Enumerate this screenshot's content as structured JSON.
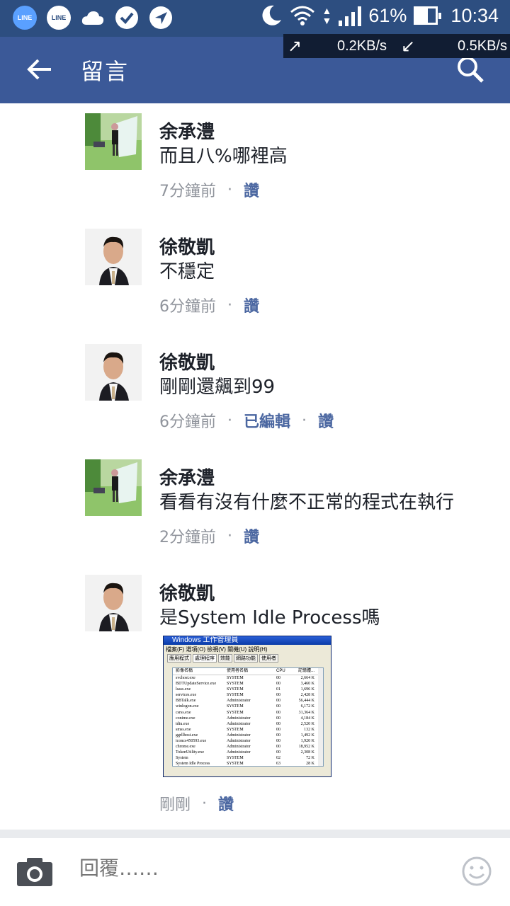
{
  "status_bar": {
    "battery": "61%",
    "time": "10:34",
    "upload": "0.2KB/s",
    "download": "0.5KB/s",
    "line_badge_1": "LINE",
    "line_badge_2": "LINE"
  },
  "app_bar": {
    "title": "留言"
  },
  "comments": [
    {
      "name": "余承澧",
      "text": "而且八%哪裡高",
      "time": "7分鐘前",
      "edited": "",
      "like": "讚",
      "avatar": "park"
    },
    {
      "name": "徐敬凱",
      "text": "不穩定",
      "time": "6分鐘前",
      "edited": "",
      "like": "讚",
      "avatar": "man"
    },
    {
      "name": "徐敬凱",
      "text": "剛剛還飆到99",
      "time": "6分鐘前",
      "edited": "已編輯",
      "like": "讚",
      "avatar": "man"
    },
    {
      "name": "余承澧",
      "text": "看看有沒有什麼不正常的程式在執行",
      "time": "2分鐘前",
      "edited": "",
      "like": "讚",
      "avatar": "park"
    },
    {
      "name": "徐敬凱",
      "text": "是System Idle Process嗎",
      "time": "剛剛",
      "edited": "",
      "like": "讚",
      "avatar": "man"
    }
  ],
  "attachment": {
    "title": "Windows 工作管理員",
    "menu": "檔案(F)  選項(O)  檢視(V)  關機(U)  說明(H)",
    "tabs": [
      "應用程式",
      "處理程序",
      "效能",
      "網路功能",
      "使用者"
    ],
    "columns": [
      "影像名稱",
      "使用者名稱",
      "CPU",
      "記憶體..."
    ],
    "rows": [
      [
        "svchost.exe",
        "SYSTEM",
        "00",
        "2,664 K"
      ],
      [
        "BDTUpdateService.exe",
        "SYSTEM",
        "00",
        "3,460 K"
      ],
      [
        "lsass.exe",
        "SYSTEM",
        "01",
        "1,696 K"
      ],
      [
        "services.exe",
        "SYSTEM",
        "00",
        "2,428 K"
      ],
      [
        "BBTalk.exe",
        "Administrator",
        "00",
        "56,444 K"
      ],
      [
        "winlogon.exe",
        "SYSTEM",
        "00",
        "6,172 K"
      ],
      [
        "csrss.exe",
        "SYSTEM",
        "00",
        "31,364 K"
      ],
      [
        "conime.exe",
        "Administrator",
        "00",
        "4,184 K"
      ],
      [
        "tdtu.exe",
        "Administrator",
        "00",
        "2,520 K"
      ],
      [
        "smss.exe",
        "SYSTEM",
        "00",
        "132 K"
      ],
      [
        "ggrllhost.exe",
        "Administrator",
        "00",
        "1,492 K"
      ],
      [
        "iconcs450593.exe",
        "Administrator",
        "00",
        "1,920 K"
      ],
      [
        "chrome.exe",
        "Administrator",
        "00",
        "18,952 K"
      ],
      [
        "TokenUtility.exe",
        "Administrator",
        "00",
        "2,308 K"
      ],
      [
        "System",
        "SYSTEM",
        "02",
        "72 K"
      ],
      [
        "System Idle Process",
        "SYSTEM",
        "63",
        "28 K"
      ]
    ]
  },
  "composer": {
    "placeholder": "回覆……"
  }
}
